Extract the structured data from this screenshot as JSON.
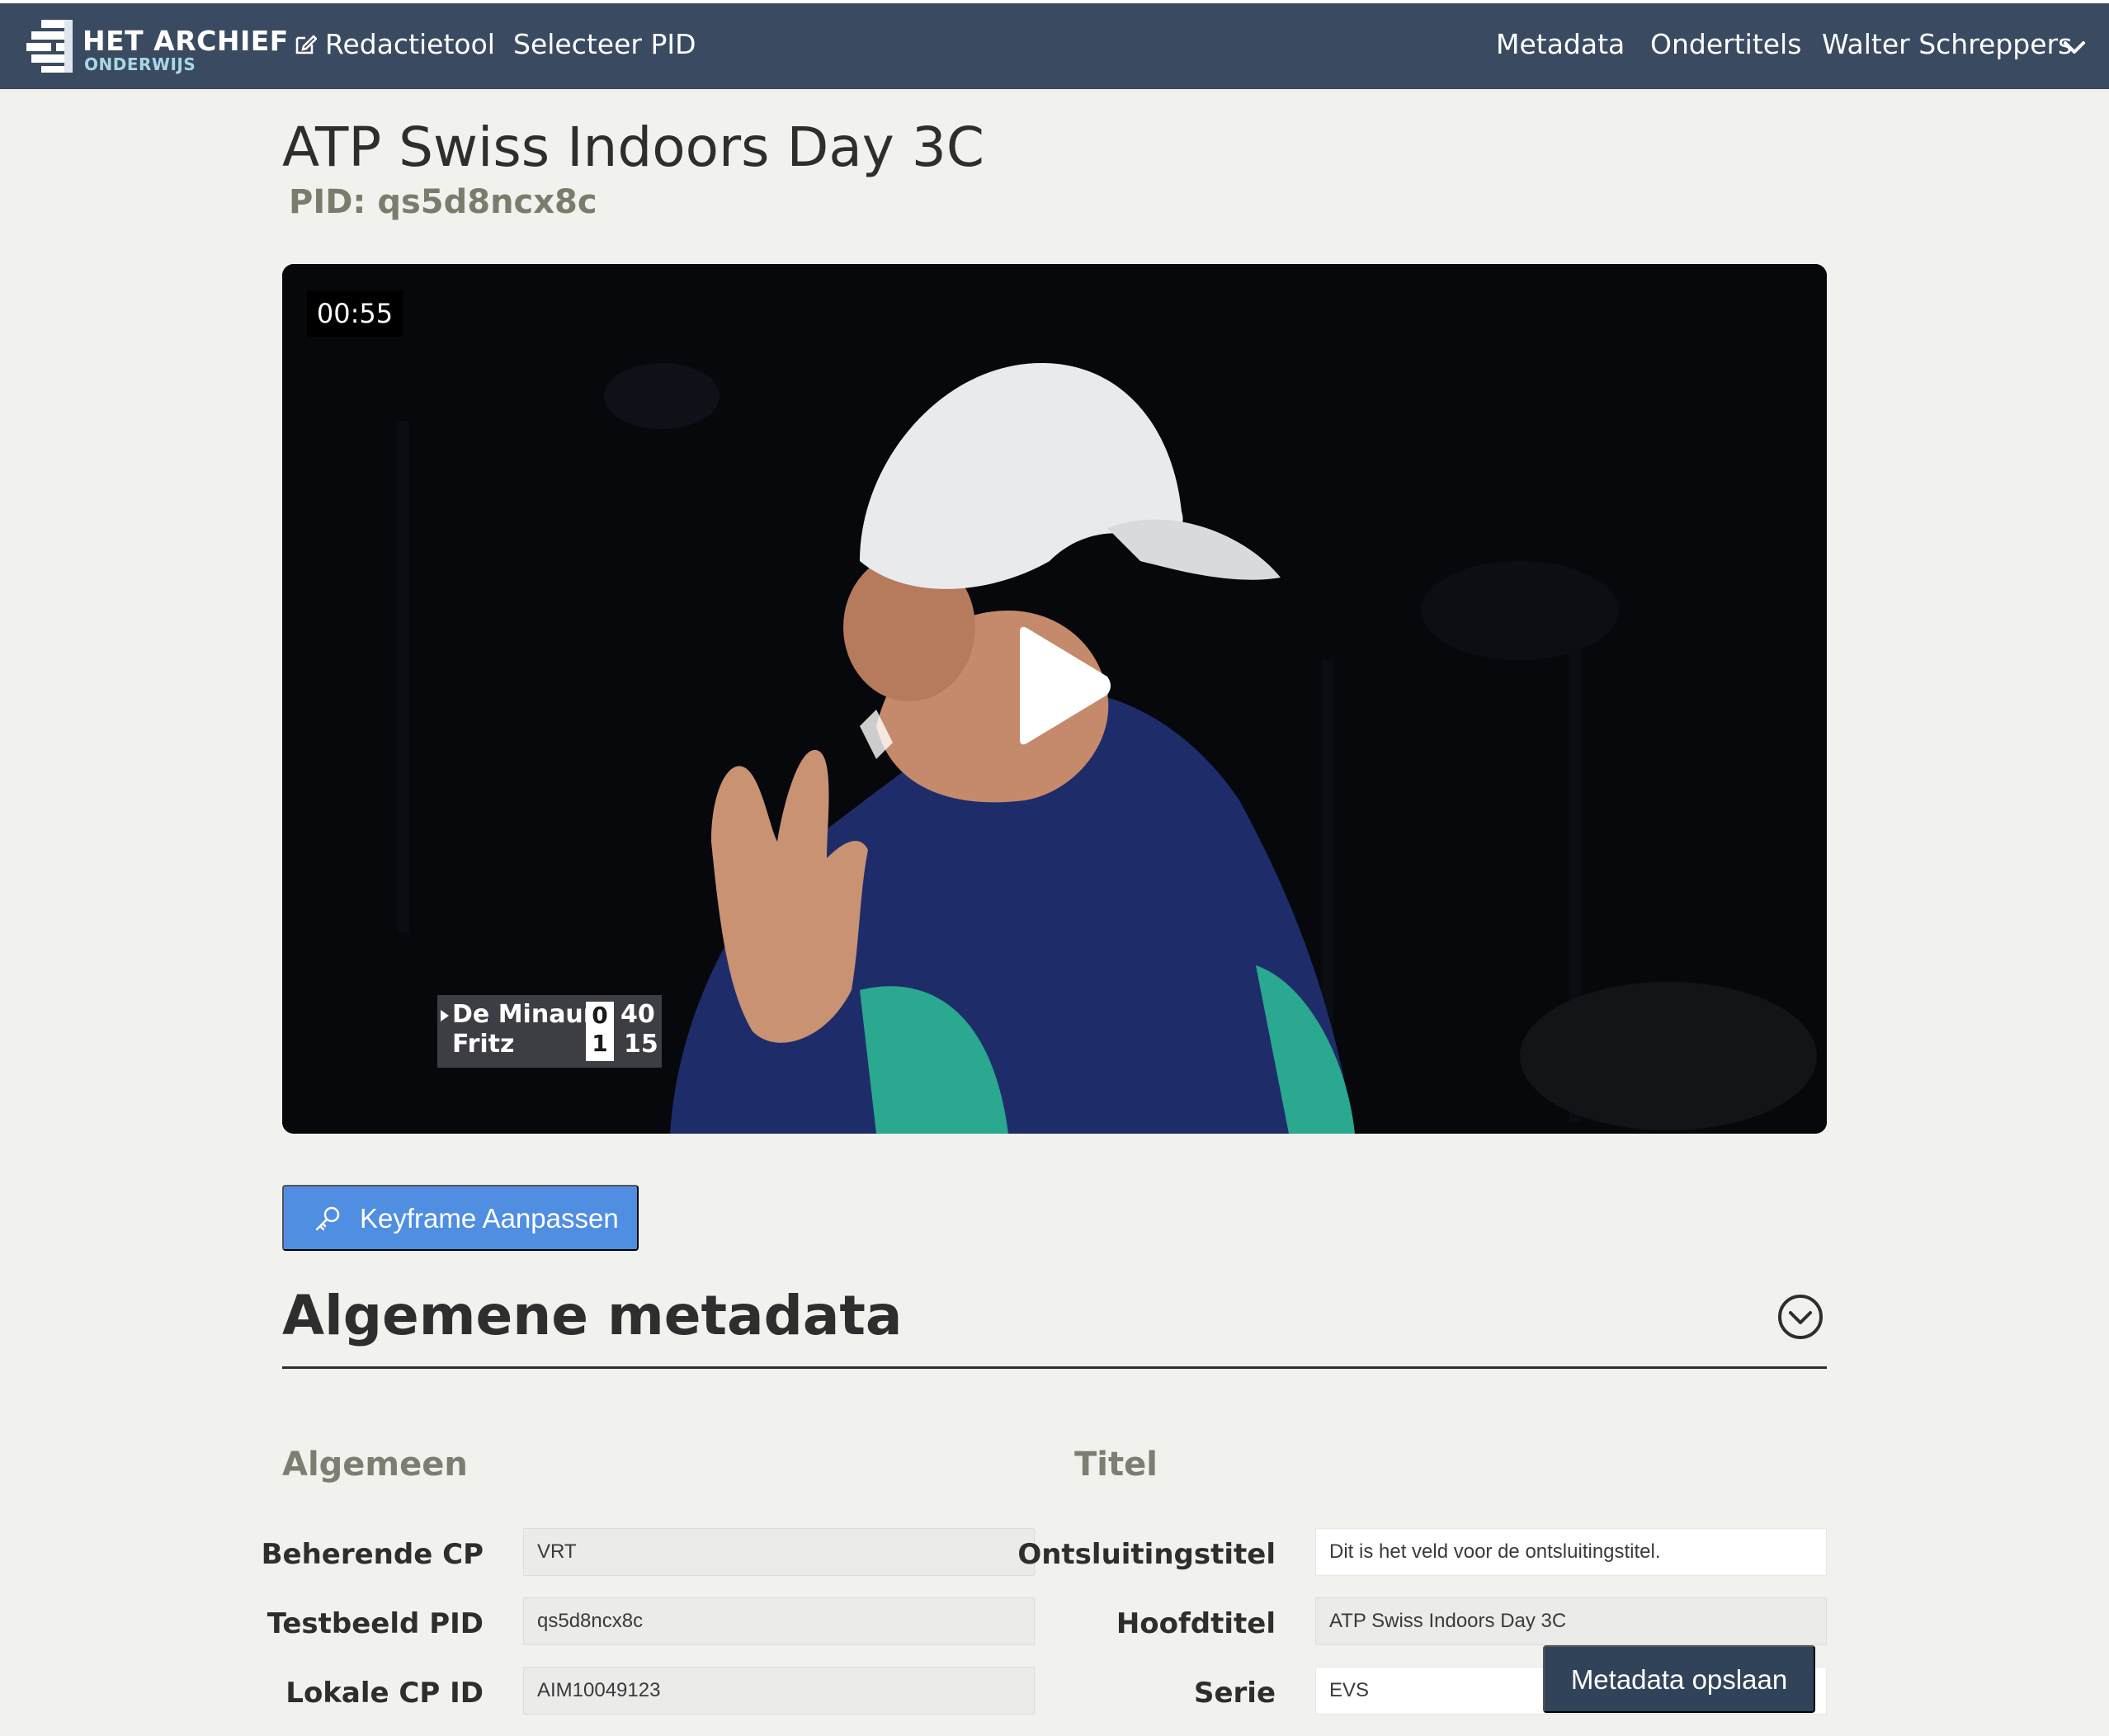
{
  "nav": {
    "brand_line1": "HET ARCHIEF",
    "brand_line2": "ONDERWIJS",
    "redactietool": "Redactietool",
    "selecteer_pid": "Selecteer PID",
    "metadata": "Metadata",
    "ondertitels": "Ondertitels",
    "user": "Walter Schreppers"
  },
  "header": {
    "title": "ATP Swiss Indoors Day 3C",
    "pid": "PID: qs5d8ncx8c"
  },
  "player": {
    "timecode": "00:55",
    "scoreboard": {
      "player1": "De Minaur",
      "player2": "Fritz",
      "set1": "0",
      "set2": "1",
      "game1": "40",
      "game2": "15"
    }
  },
  "keyframe_button": "Keyframe Aanpassen",
  "section": {
    "title": "Algemene metadata"
  },
  "algemeen": {
    "heading": "Algemeen",
    "beherende_cp_label": "Beherende CP",
    "beherende_cp_value": "VRT",
    "testbeeld_pid_label": "Testbeeld PID",
    "testbeeld_pid_value": "qs5d8ncx8c",
    "lokale_cp_id_label": "Lokale CP ID",
    "lokale_cp_id_value": "AIM10049123"
  },
  "titel": {
    "heading": "Titel",
    "ontsluitingstitel_label": "Ontsluitingstitel",
    "ontsluitingstitel_value": "Dit is het veld voor de ontsluitingstitel.",
    "hoofdtitel_label": "Hoofdtitel",
    "hoofdtitel_value": "ATP Swiss Indoors Day 3C",
    "serie_label": "Serie",
    "serie_value": "EVS"
  },
  "save_button": "Metadata opslaan",
  "colors": {
    "navbar": "#3a4b61",
    "page_background": "#f1f1ed",
    "primary_button": "#4f8ee0",
    "save_button": "#304359",
    "muted_text": "#7a7d6c"
  }
}
